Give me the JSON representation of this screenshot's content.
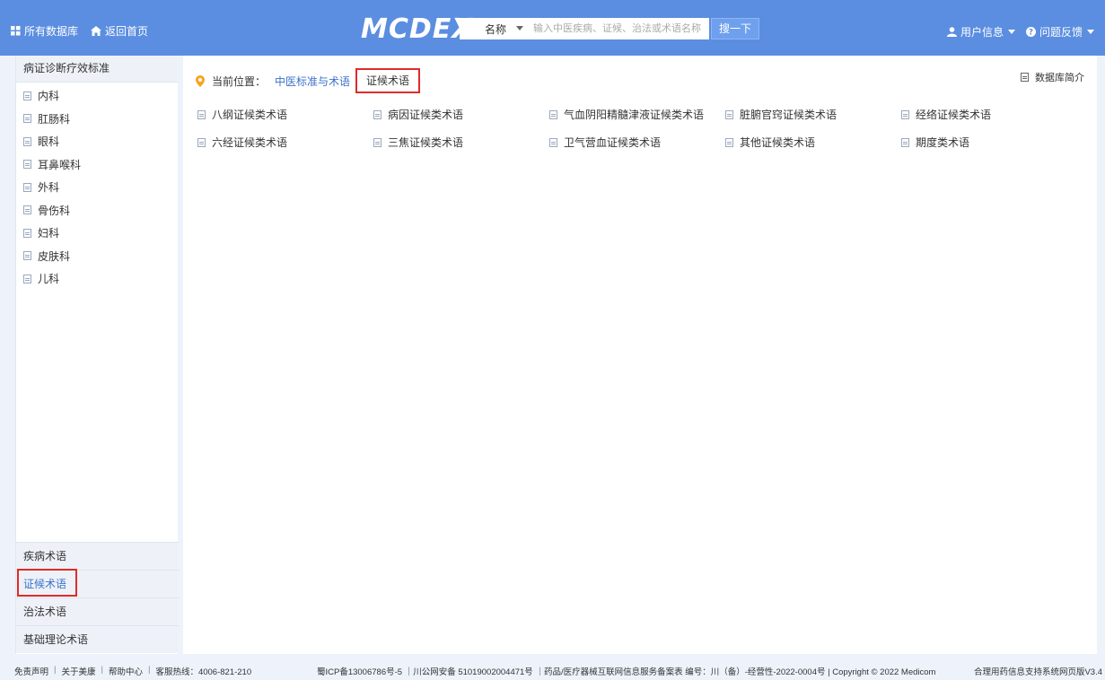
{
  "header": {
    "all_databases": "所有数据库",
    "home": "返回首页",
    "logo": "MCDEX",
    "search": {
      "field": "名称",
      "placeholder": "输入中医疾病、证候、治法或术语名称",
      "button": "搜一下"
    },
    "user_info": "用户信息",
    "feedback": "问题反馈"
  },
  "sidebar": {
    "title": "病证诊断疗效标准",
    "items": [
      "内科",
      "肛肠科",
      "眼科",
      "耳鼻喉科",
      "外科",
      "骨伤科",
      "妇科",
      "皮肤科",
      "儿科"
    ],
    "categories": [
      {
        "label": "疾病术语",
        "active": false
      },
      {
        "label": "证候术语",
        "active": true
      },
      {
        "label": "治法术语",
        "active": false
      },
      {
        "label": "基础理论术语",
        "active": false
      }
    ]
  },
  "main": {
    "breadcrumb": {
      "label": "当前位置：",
      "parent": "中医标准与术语",
      "current": "证候术语"
    },
    "intro": "数据库简介",
    "rows": [
      [
        "八纲证候类术语",
        "病因证候类术语",
        "气血阴阳精髓津液证候类术语",
        "脏腑官窍证候类术语",
        "经络证候类术语"
      ],
      [
        "六经证候类术语",
        "三焦证候类术语",
        "卫气营血证候类术语",
        "其他证候类术语",
        "期度类术语"
      ]
    ]
  },
  "footer": {
    "links": [
      "免责声明",
      "关于美康",
      "帮助中心"
    ],
    "hotline": "客服热线：4006-821-210",
    "icp": "蜀ICP备13006786号-5 ｜川公网安备 51019002004471号 ｜药品/医疗器械互联网信息服务备案表 编号：川（备）-经营性-2022-0004号 | Copyright © 2022 Medicom",
    "version": "合理用药信息支持系统网页版V3.4"
  },
  "colors": {
    "header_bg": "#5b8ee0",
    "accent": "#3a73c9",
    "highlight": "#e02a2a"
  }
}
